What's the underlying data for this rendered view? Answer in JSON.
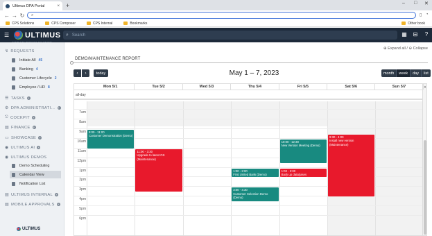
{
  "browser": {
    "tab_title": "Ultimus DPA Portal",
    "tab_close": "×",
    "new_tab": "+",
    "window_controls": {
      "minimize": "–",
      "maximize": "□",
      "close": "✕"
    },
    "nav": {
      "back": "←",
      "forward": "→",
      "reload": "↻"
    },
    "address_value": "",
    "address_icon": "⌕",
    "bookmarks": [
      "CPS Solutions",
      "CPS Composer",
      "CPS Internal",
      "Bookmarks"
    ],
    "other_bookmarks": "Other book"
  },
  "header": {
    "menu_icon": "☰",
    "brand": "ULTIMUS",
    "brand_tagline": "COMPLETE PROCESS SOLUTIONS",
    "search_placeholder": "Search",
    "search_icon": "⌕",
    "icons": [
      "▦",
      "⊟",
      "?"
    ]
  },
  "sidebar": {
    "requests": {
      "label": "REQUESTS",
      "icon": "↯"
    },
    "request_items": [
      {
        "label": "Initiate All",
        "badge": "45"
      },
      {
        "label": "Banking",
        "badge": "4"
      },
      {
        "label": "Customer Lifecycle",
        "badge": "2"
      },
      {
        "label": "Employee / HR",
        "badge": "8"
      }
    ],
    "sections_a": [
      {
        "label": "TASKS",
        "icon": "☰"
      },
      {
        "label": "DPA ADMINISTRATI…",
        "icon": "⚙"
      },
      {
        "label": "COCKPIT",
        "icon": "⎋"
      },
      {
        "label": "FINANCE",
        "icon": "▤"
      },
      {
        "label": "SHOWCASE",
        "icon": "▭"
      },
      {
        "label": "ULTIMUS AI",
        "icon": "◉"
      },
      {
        "label": "ULTIMUS DEMOS",
        "icon": "◉"
      }
    ],
    "demo_items": [
      {
        "label": "Demo Scheduling"
      },
      {
        "label": "Calendar View"
      },
      {
        "label": "Notification List"
      }
    ],
    "sections_b": [
      {
        "label": "ULTIMUS INTERNAL",
        "icon": "▤"
      },
      {
        "label": "MOBILE APPROVALS",
        "icon": "▤"
      }
    ],
    "plus": "+",
    "footer_brand": "ULTIMUS"
  },
  "main": {
    "expand_collapse": "⊕ Expand all / ⊖ Collapse",
    "report_title": "DEMO/MAINTENANCE REPORT",
    "prev": "‹",
    "next": "›",
    "today": "today",
    "range_title": "May 1 – 7, 2023",
    "views": [
      "month",
      "week",
      "day",
      "list"
    ],
    "active_view": "week"
  },
  "calendar": {
    "all_day_label": "all-day",
    "days": [
      "Mon 5/1",
      "Tue 5/2",
      "Wed 5/3",
      "Thu 5/4",
      "Fri 5/5",
      "Sat 5/6",
      "Sun 5/7"
    ],
    "hours": [
      "7am",
      "8am",
      "9am",
      "10am",
      "11am",
      "12pm",
      "1pm",
      "2pm",
      "3pm",
      "4pm",
      "5pm",
      "6pm"
    ],
    "colors": {
      "demo": "#188a80",
      "maintenance": "#e8192c"
    },
    "events": [
      {
        "day": 0,
        "time": "9:00 - 11:00",
        "title": "Customer Demonstration (Demo)",
        "kind": "demo",
        "start": 9.0,
        "end": 11.0
      },
      {
        "day": 1,
        "time": "11:00 - 3:30",
        "title": "Upgrade to latest OS (Maintenance)",
        "kind": "maintenance",
        "start": 11.0,
        "end": 15.5
      },
      {
        "day": 3,
        "time": "1:00 - 2:00",
        "title": "First United Bank (Demo)",
        "kind": "demo",
        "start": 13.0,
        "end": 14.0
      },
      {
        "day": 3,
        "time": "3:00 - 4:30",
        "title": "Customer Selection Demo (Demo)",
        "kind": "demo",
        "start": 15.0,
        "end": 16.5
      },
      {
        "day": 4,
        "time": "10:00 - 12:30",
        "title": "New Version Meeting (Demo)",
        "kind": "demo",
        "start": 10.0,
        "end": 12.5
      },
      {
        "day": 4,
        "time": "1:00 - 2:00",
        "title": "Back up databases (Maintenance)",
        "kind": "maintenance",
        "start": 13.0,
        "end": 14.0
      },
      {
        "day": 5,
        "time": "9:30 - 4:00",
        "title": "Install new version (Maintenance)",
        "kind": "maintenance",
        "start": 9.5,
        "end": 16.0
      }
    ]
  }
}
